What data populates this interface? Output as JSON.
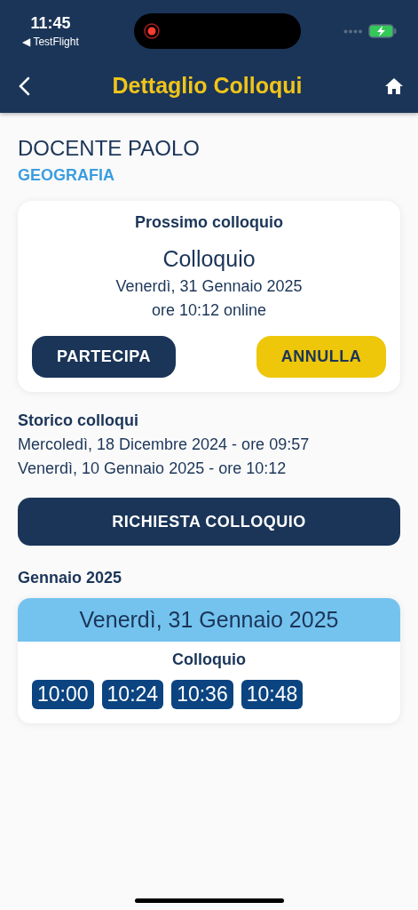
{
  "status_bar": {
    "time": "11:45",
    "back_app": "◀ TestFlight"
  },
  "nav": {
    "title": "Dettaglio Colloqui"
  },
  "teacher": {
    "name": "DOCENTE PAOLO",
    "subject": "GEOGRAFIA"
  },
  "next_meeting": {
    "heading": "Prossimo colloquio",
    "title": "Colloquio",
    "date": "Venerdì, 31 Gennaio 2025",
    "time": "ore 10:12 online",
    "buttons": [
      {
        "label": "PARTECIPA",
        "kind": "primary"
      },
      {
        "label": "ANNULLA",
        "kind": "warning"
      }
    ]
  },
  "history": {
    "heading": "Storico colloqui",
    "items": [
      "Mercoledì, 18 Dicembre 2024 - ore 09:57",
      "Venerdì, 10 Gennaio 2025 - ore 10:12"
    ]
  },
  "request_button": "RICHIESTA COLLOQUIO",
  "month": "Gennaio 2025",
  "day_card": {
    "date": "Venerdì, 31 Gennaio 2025",
    "label": "Colloquio",
    "slots": [
      "10:00",
      "10:24",
      "10:36",
      "10:48"
    ]
  }
}
